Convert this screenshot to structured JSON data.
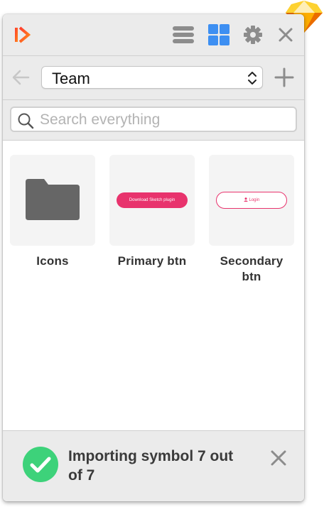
{
  "app": {
    "logo_icon": "plugin-logo-icon",
    "corner_icon": "sketch-diamond-icon"
  },
  "header": {
    "icons": [
      "list-view-icon",
      "grid-view-icon",
      "gear-icon",
      "close-icon"
    ],
    "active_view": "grid",
    "accent_color": "#3d8ff2"
  },
  "nav": {
    "back_icon": "arrow-left-icon",
    "library_select": "Team",
    "add_icon": "plus-icon"
  },
  "search": {
    "placeholder": "Search everything",
    "value": ""
  },
  "items": [
    {
      "caption": "Icons",
      "thumb": "folder-icon"
    },
    {
      "caption": "Primary btn",
      "thumb_text": "Download Sketch plugin"
    },
    {
      "caption": "Secondary btn",
      "thumb_text": "Login",
      "thumb_icon": "user-icon"
    }
  ],
  "status": {
    "message": "Importing symbol 7 out of 7",
    "icon": "check-circle-icon",
    "success_color": "#3dd27a"
  },
  "brand": {
    "pink": "#e8336d"
  }
}
